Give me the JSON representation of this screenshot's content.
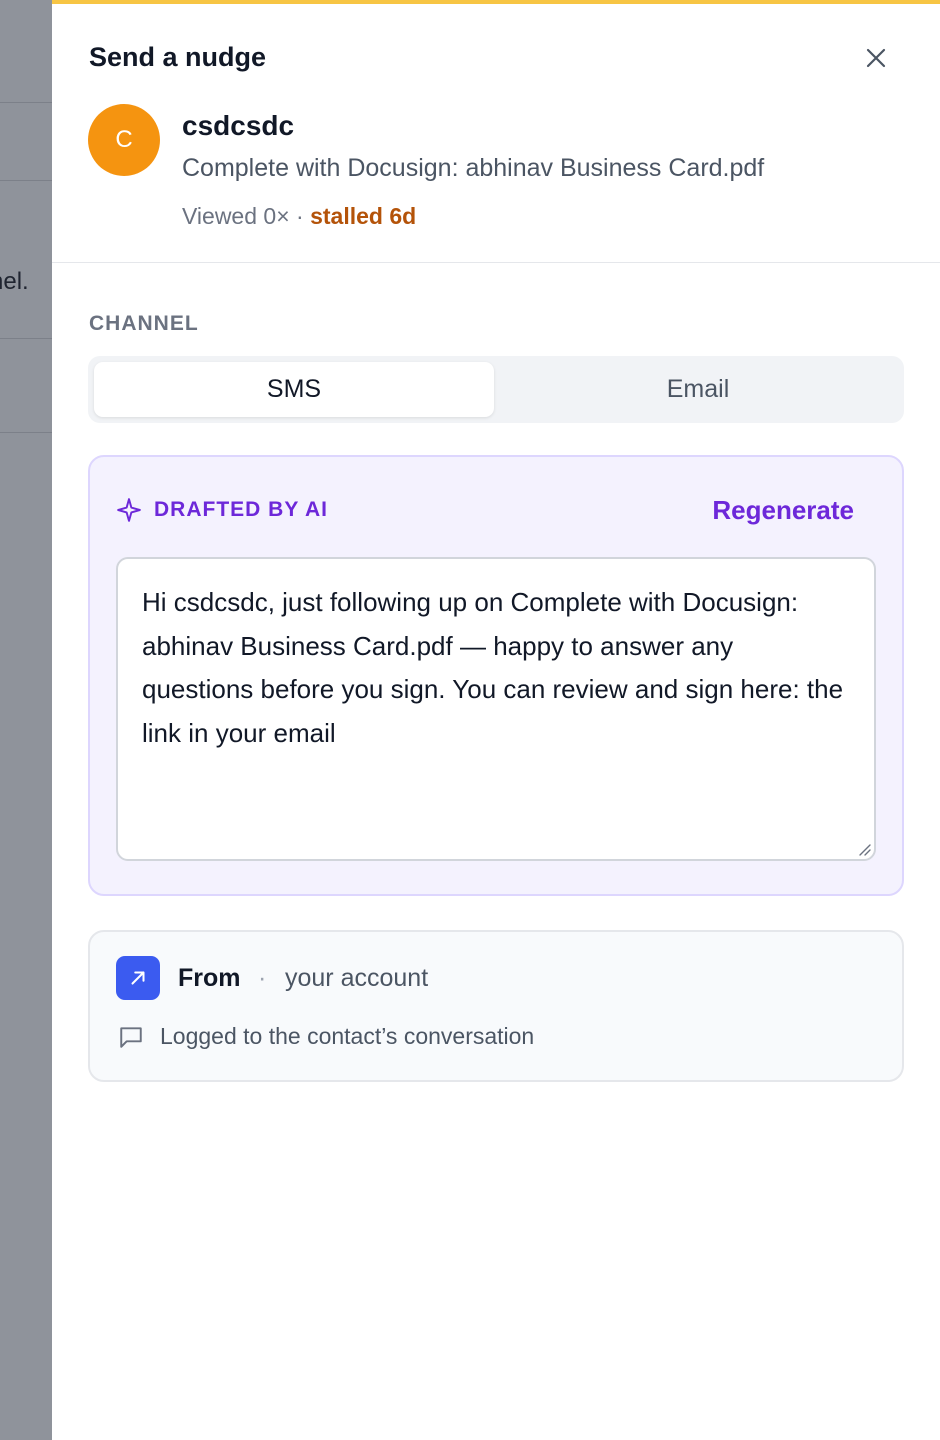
{
  "backdrop": {
    "partial_text": "nel."
  },
  "drawer": {
    "title": "Send a nudge",
    "close_icon": "close-icon"
  },
  "contact": {
    "avatar_initial": "C",
    "avatar_color": "#f59410",
    "name": "csdcsdc",
    "document": "Complete with Docusign: abhinav Business Card.pdf",
    "viewed": "Viewed 0×",
    "separator": "·",
    "status": "stalled 6d",
    "status_color": "#b45309"
  },
  "channel": {
    "label": "CHANNEL",
    "options": [
      "SMS",
      "Email"
    ],
    "selected": "SMS"
  },
  "ai_draft": {
    "icon": "sparkle-icon",
    "label": "DRAFTED BY AI",
    "regenerate_label": "Regenerate",
    "accent_color": "#6d28d9",
    "message": "Hi csdcsdc, just following up on Complete with Docusign: abhinav Business Card.pdf — happy to answer any questions before you sign. You can review and sign here: the link in your email"
  },
  "sender": {
    "icon": "arrow-up-right-icon",
    "from_label": "From",
    "separator": "·",
    "from_value": "your account",
    "log_icon": "chat-bubble-icon",
    "log_text": "Logged to the contact’s conversation",
    "icon_color": "#3b5bf0"
  }
}
